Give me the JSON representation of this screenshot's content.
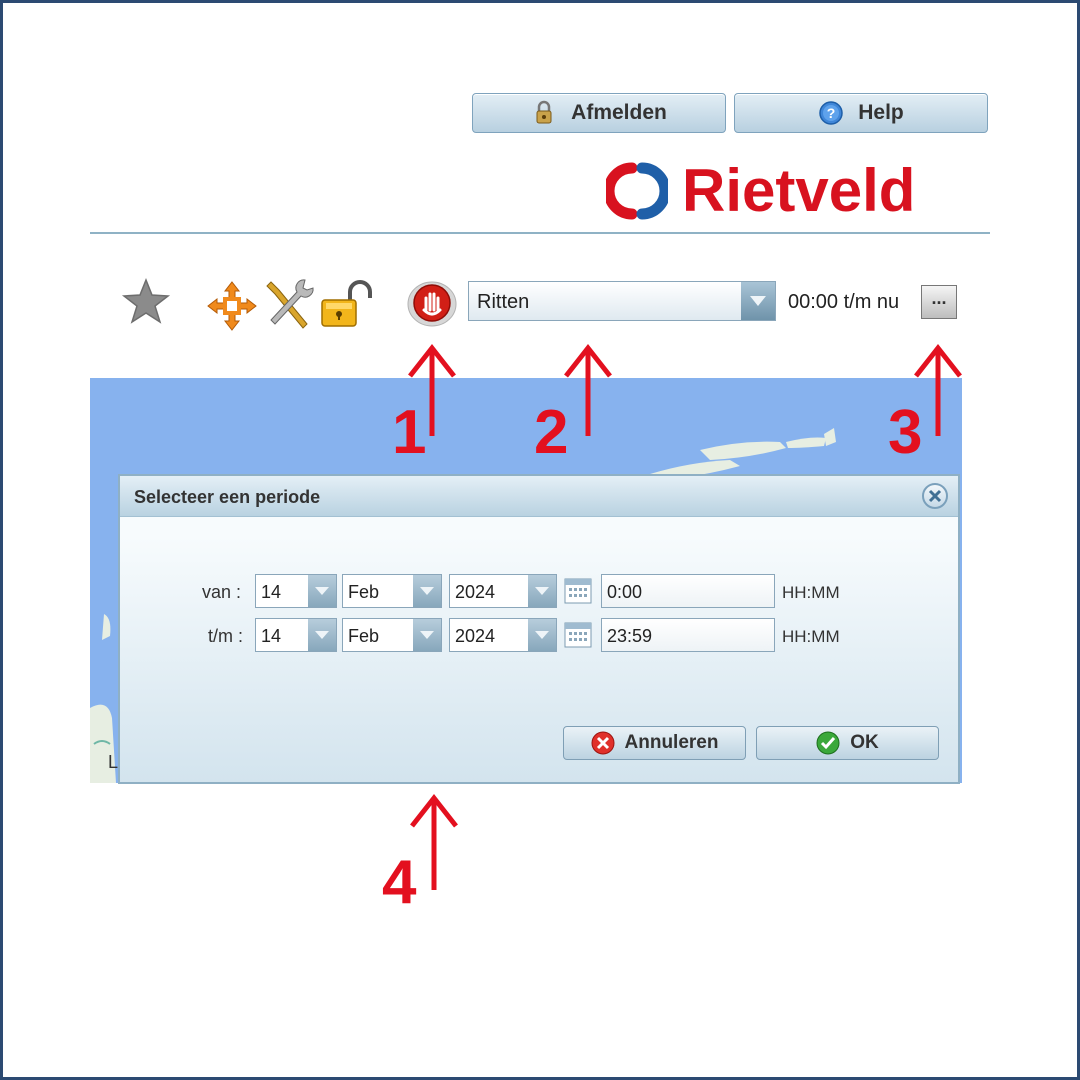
{
  "header": {
    "logout_label": "Afmelden",
    "help_label": "Help",
    "brand_name": "Rietveld"
  },
  "toolbar": {
    "report_select_value": "Ritten",
    "period_text": "00:00 t/m nu",
    "period_button_label": "..."
  },
  "markers": [
    "1",
    "2",
    "3",
    "4"
  ],
  "dialog": {
    "title": "Selecteer een periode",
    "from": {
      "label": "van :",
      "day": "14",
      "month": "Feb",
      "year": "2024",
      "time": "0:00",
      "format": "HH:MM"
    },
    "to": {
      "label": "t/m :",
      "day": "14",
      "month": "Feb",
      "year": "2024",
      "time": "23:59",
      "format": "HH:MM"
    },
    "cancel_label": "Annuleren",
    "ok_label": "OK"
  },
  "map": {
    "corner_letter": "L"
  },
  "colors": {
    "brand_red": "#d8121f",
    "marker_red": "#e3101f",
    "water": "#87b2ee",
    "land": "#e7eee2"
  }
}
